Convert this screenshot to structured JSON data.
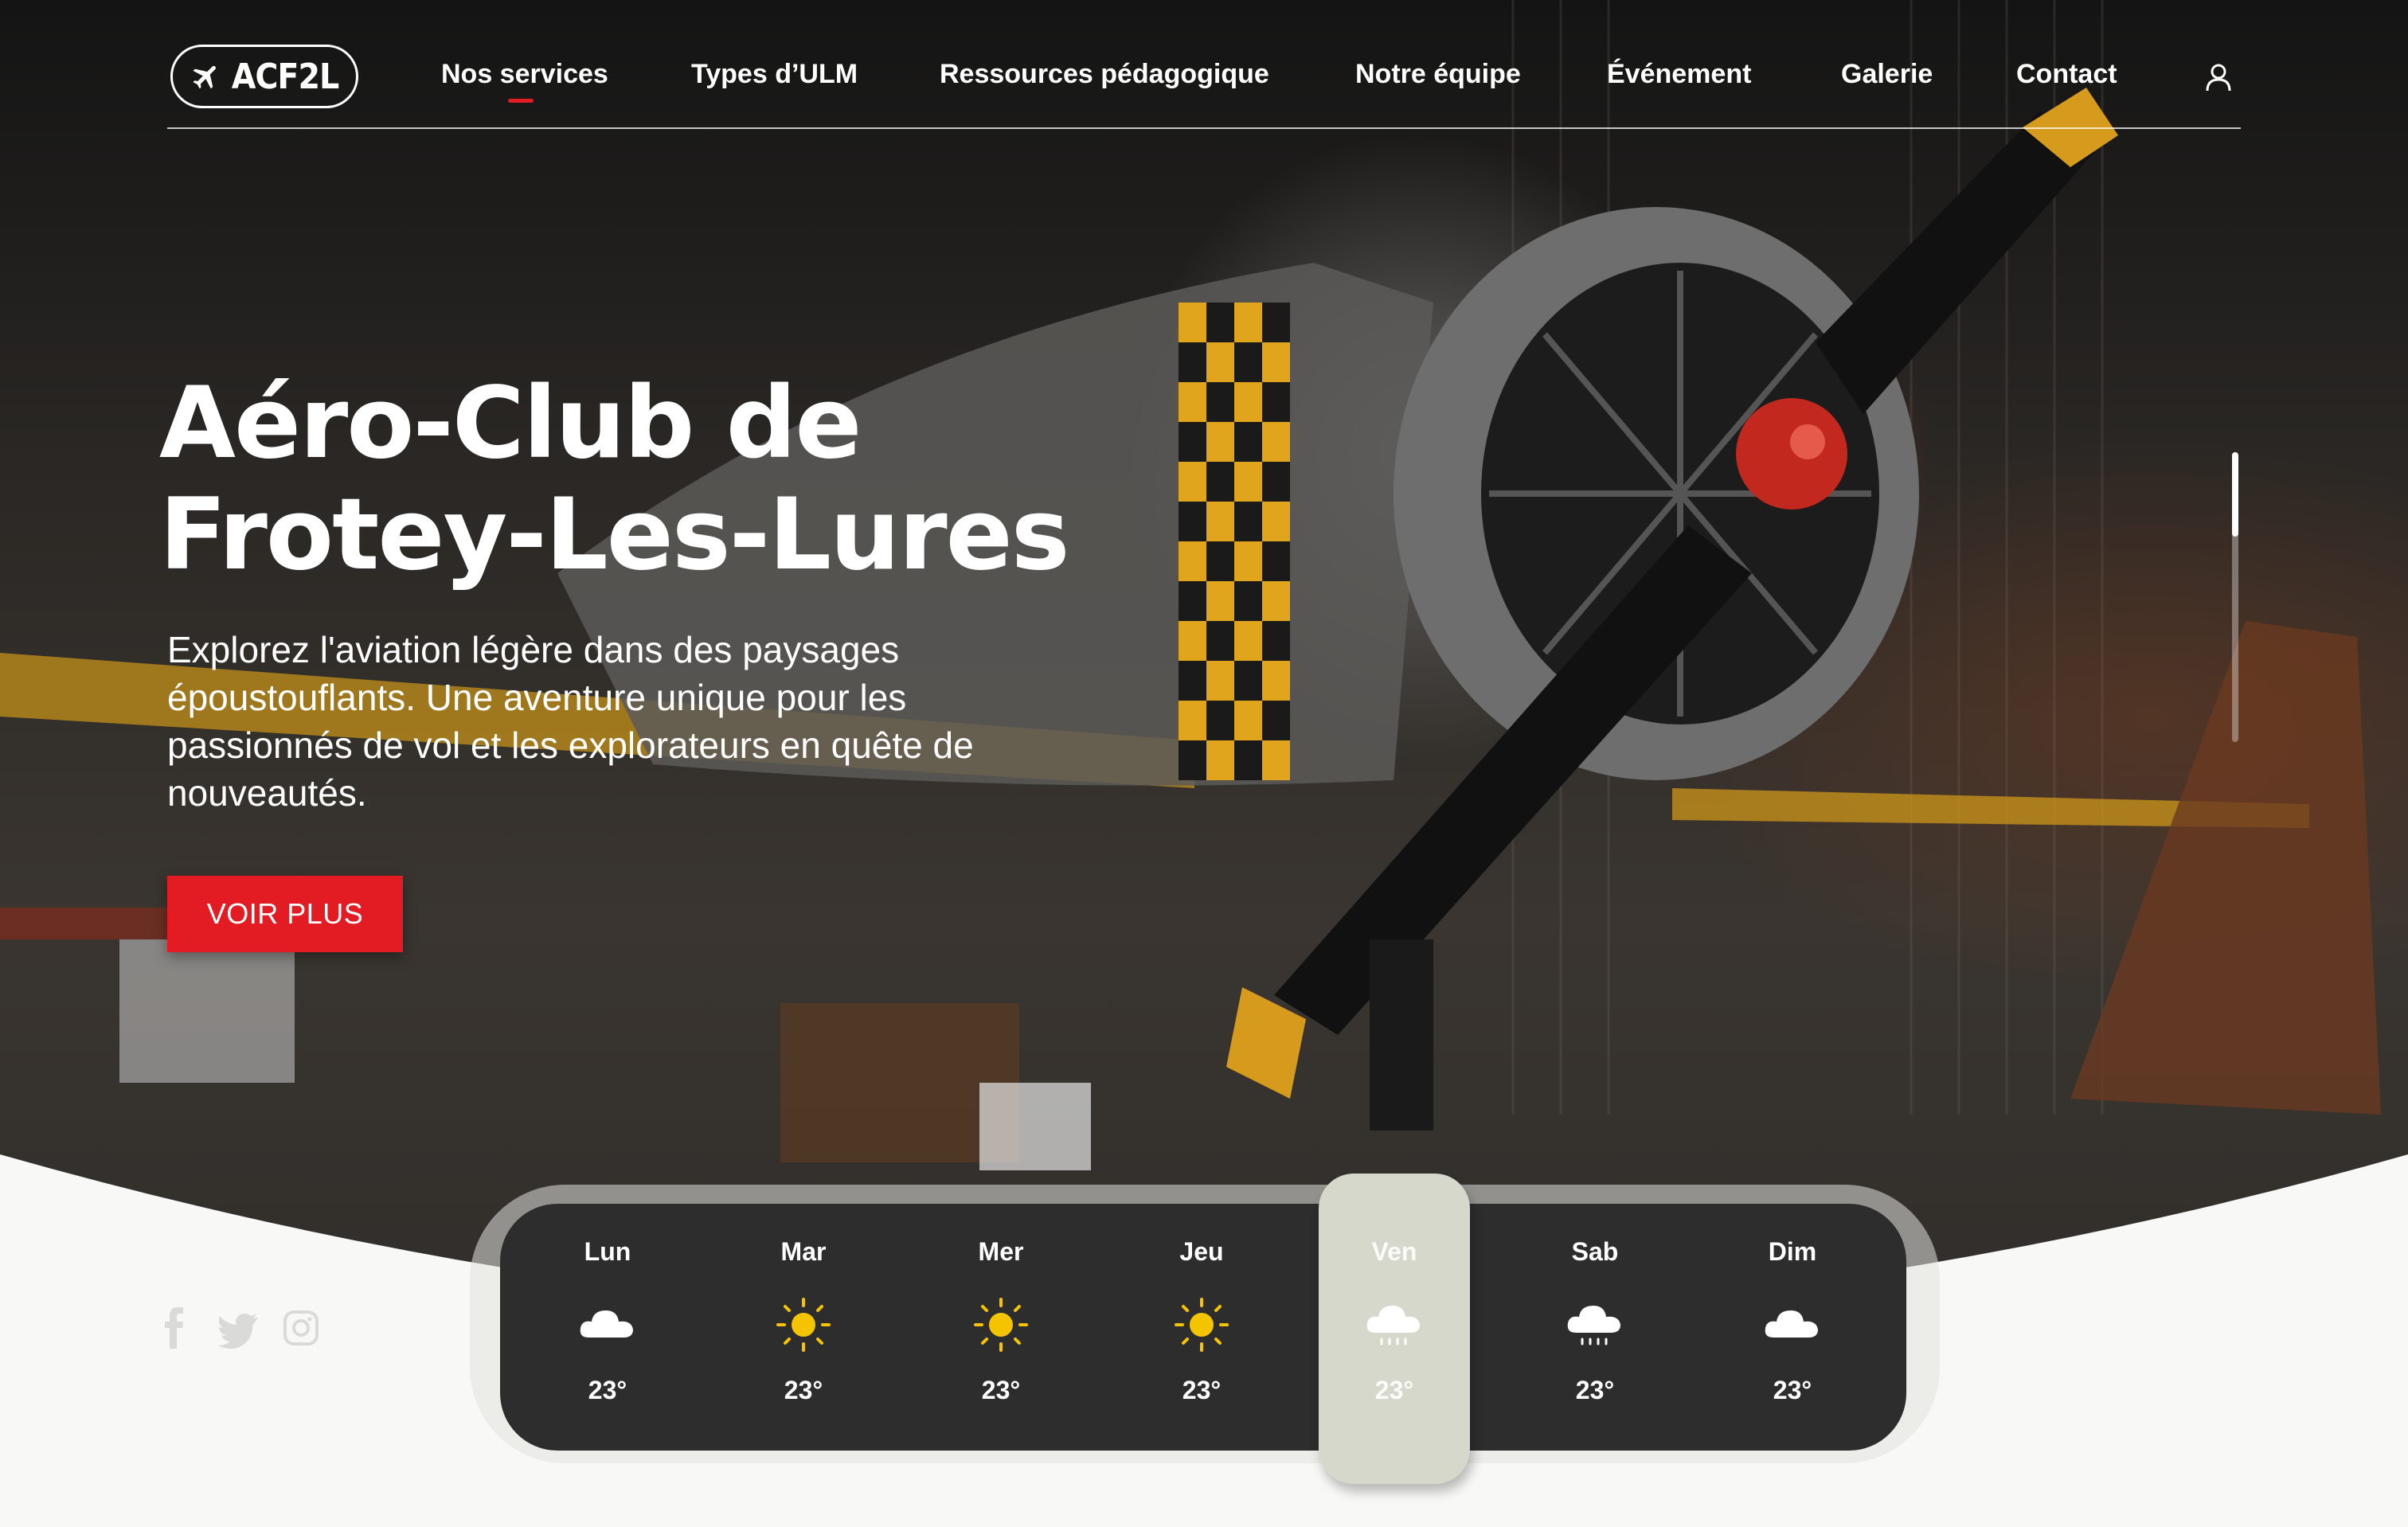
{
  "brand": {
    "logo_text": "ACF2L",
    "logo_icon": "plane-icon"
  },
  "nav": {
    "items": [
      {
        "label": "Nos services",
        "active": true
      },
      {
        "label": "Types d’ULM"
      },
      {
        "label": "Ressources pédagogique"
      },
      {
        "label": "Notre équipe"
      },
      {
        "label": "Événement"
      },
      {
        "label": "Galerie"
      },
      {
        "label": "Contact"
      }
    ],
    "account_icon": "user-icon"
  },
  "hero": {
    "title_line1": "Aéro-Club de",
    "title_line2": "Frotey-Les-Lures",
    "description": "Explorez l'aviation légère dans des paysages époustouflants. Une aventure unique pour les passionnés de vol et les explorateurs en quête de nouveautés.",
    "cta_label": "VOIR PLUS"
  },
  "social": [
    {
      "icon": "facebook-icon"
    },
    {
      "icon": "twitter-icon"
    },
    {
      "icon": "instagram-icon"
    }
  ],
  "weather": {
    "days": [
      {
        "day": "Lun",
        "icon": "cloud-icon",
        "temp": "23°"
      },
      {
        "day": "Mar",
        "icon": "sun-icon",
        "temp": "23°"
      },
      {
        "day": "Mer",
        "icon": "sun-icon",
        "temp": "23°"
      },
      {
        "day": "Jeu",
        "icon": "sun-icon",
        "temp": "23°"
      },
      {
        "day": "Ven",
        "icon": "rain-cloud-icon",
        "temp": "23°",
        "active": true
      },
      {
        "day": "Sab",
        "icon": "rain-cloud-icon",
        "temp": "23°"
      },
      {
        "day": "Dim",
        "icon": "cloud-icon",
        "temp": "23°"
      }
    ]
  },
  "colors": {
    "accent": "#e31b23",
    "weather_bar": "#2d2d2d",
    "active_day": "#d6d8cc",
    "sun": "#f5c400",
    "page_bg": "#f8f8f6"
  }
}
